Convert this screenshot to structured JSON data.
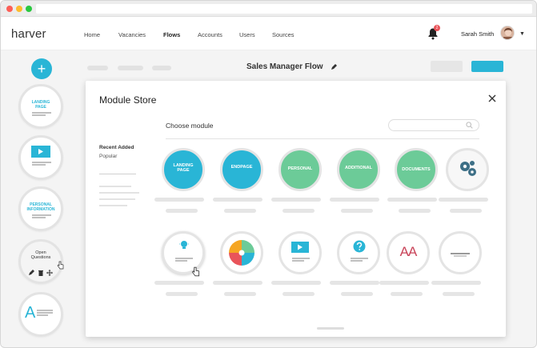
{
  "app": {
    "logo_text": "harver",
    "nav": [
      "Home",
      "Vacancies",
      "Flows",
      "Accounts",
      "Users",
      "Sources"
    ],
    "active_nav": "Flows",
    "notifications_count": "2",
    "user_name": "Sarah Smith"
  },
  "sidebar": {
    "add_label": "+",
    "cards": [
      {
        "label": "LANDING\nPAGE"
      },
      {
        "label": ""
      },
      {
        "label": "PERSONAL\nINFORMATION"
      },
      {
        "label": "Open\nQuestions"
      },
      {
        "label": "A"
      }
    ]
  },
  "toolbar": {
    "flow_title": "Sales Manager Flow"
  },
  "modal": {
    "title": "Module Store",
    "choose_label": "Choose module",
    "search_placeholder": "",
    "categories": [
      "Recent Added",
      "Popular"
    ],
    "modules_row1": [
      "LANDING\nPAGE",
      "ENDPAGE",
      "PERSONAL",
      "ADDITIONAL",
      "DOCUMENTS",
      ""
    ],
    "modules_row2": [
      "",
      "",
      "",
      "",
      "AA",
      ""
    ]
  },
  "colors": {
    "accent_blue": "#29b5d6",
    "accent_green": "#6ccb98",
    "badge_red": "#e9545a"
  },
  "icons": {
    "edit": "pencil-icon",
    "close": "close-icon",
    "search": "search-icon",
    "notifications": "bell-icon"
  }
}
